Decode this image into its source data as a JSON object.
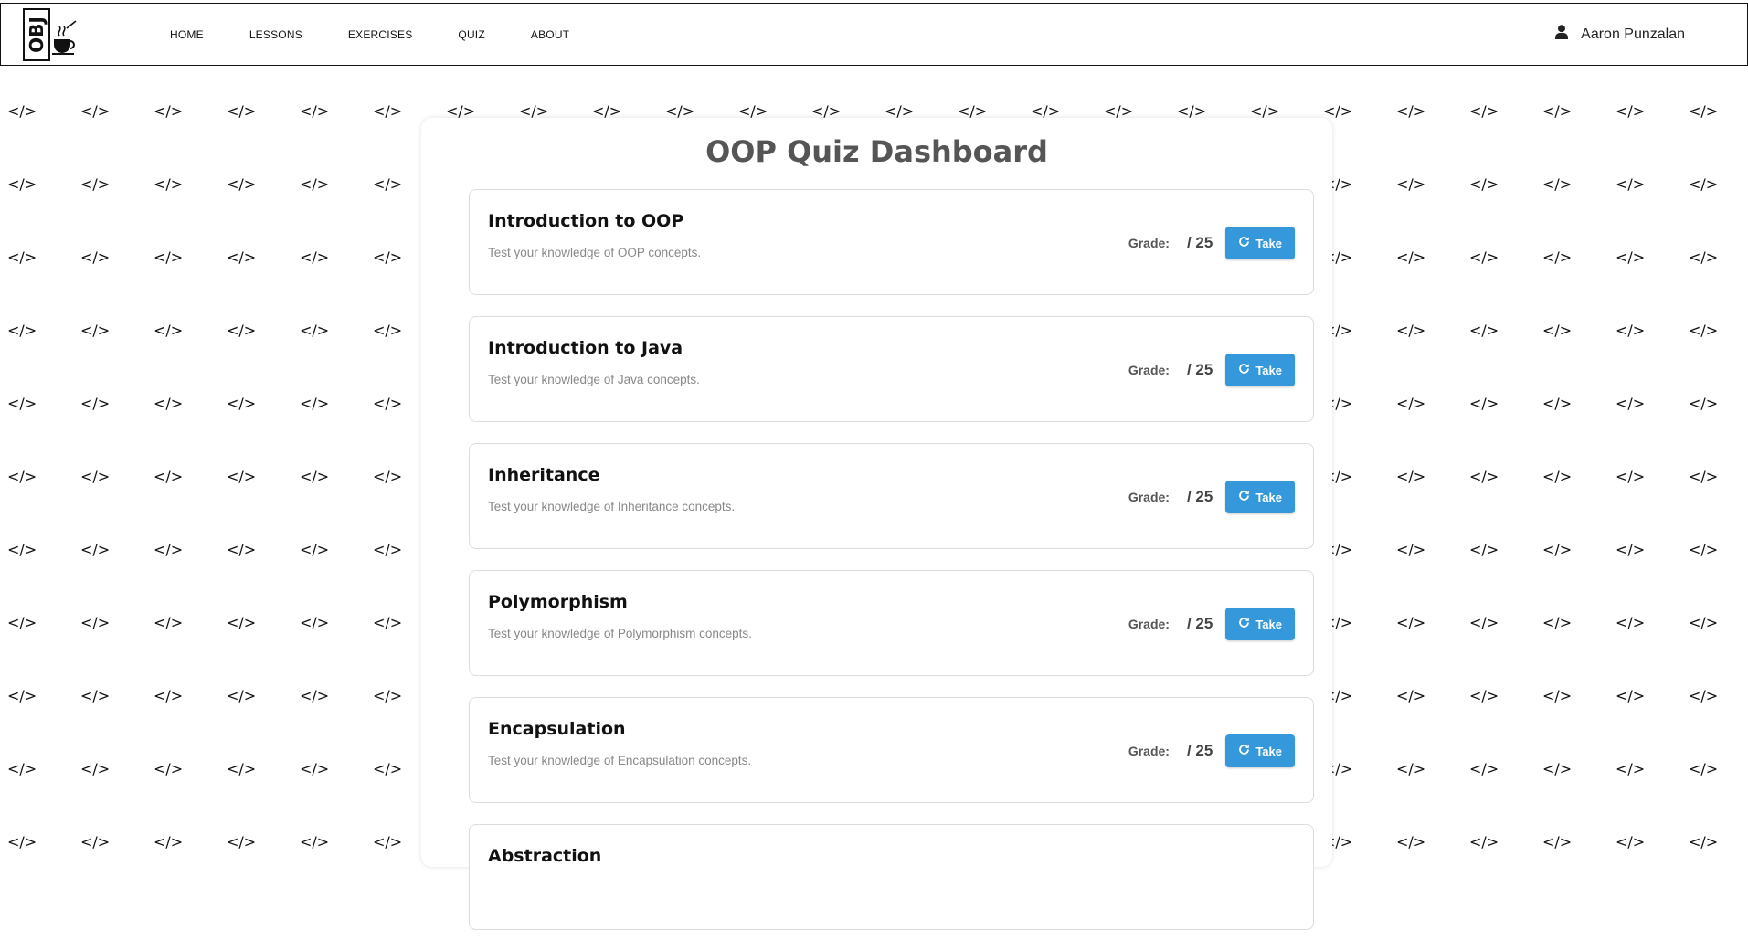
{
  "background": {
    "tag_glyph": "</>"
  },
  "nav": {
    "logo_text": "OBJ",
    "links": [
      "HOME",
      "LESSONS",
      "EXERCISES",
      "QUIZ",
      "ABOUT"
    ],
    "user": {
      "icon": "user-icon",
      "name": "Aaron Punzalan"
    }
  },
  "main": {
    "title": "OOP Quiz Dashboard",
    "quizzes": [
      {
        "title": "Introduction to OOP",
        "description": "Test your knowledge of OOP concepts.",
        "grade_label": "Grade:",
        "grade_value": "/ 25",
        "button_label": "Take",
        "button_icon": "redo-icon"
      },
      {
        "title": "Introduction to Java",
        "description": "Test your knowledge of Java concepts.",
        "grade_label": "Grade:",
        "grade_value": "/ 25",
        "button_label": "Take",
        "button_icon": "redo-icon"
      },
      {
        "title": "Inheritance",
        "description": "Test your knowledge of Inheritance concepts.",
        "grade_label": "Grade:",
        "grade_value": "/ 25",
        "button_label": "Take",
        "button_icon": "redo-icon"
      },
      {
        "title": "Polymorphism",
        "description": "Test your knowledge of Polymorphism concepts.",
        "grade_label": "Grade:",
        "grade_value": "/ 25",
        "button_label": "Take",
        "button_icon": "redo-icon"
      },
      {
        "title": "Encapsulation",
        "description": "Test your knowledge of Encapsulation concepts.",
        "grade_label": "Grade:",
        "grade_value": "/ 25",
        "button_label": "Take",
        "button_icon": "redo-icon"
      },
      {
        "title": "Abstraction",
        "description": "",
        "grade_label": "",
        "grade_value": "",
        "button_label": "",
        "button_icon": ""
      }
    ]
  },
  "colors": {
    "accent": "#3498db",
    "title": "#555555",
    "description": "#888888"
  }
}
